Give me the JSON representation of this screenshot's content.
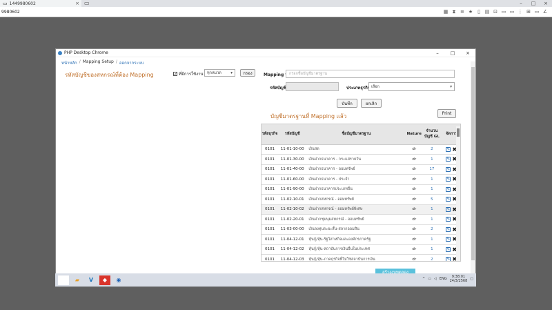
{
  "browser": {
    "tab_title": "1449980602",
    "address": "9980602"
  },
  "app": {
    "window_title": "PHP Desktop Chrome",
    "breadcrumb": [
      "หน้าหลัก",
      "Mapping Setup",
      "ออกจากระบบ"
    ]
  },
  "left": {
    "title": "รหัสบัญชีของสหกรณ์ที่ต้อง Mapping",
    "checkbox_label": "ที่มีการใช้งาน",
    "checkbox_checked": true,
    "filter_value": "ทุกหมวด",
    "filter_button": "กรอง"
  },
  "form": {
    "mapping_to_label": "Mapping to",
    "mapping_to_placeholder": "กรอกชื่อบัญชีมาตรฐาน",
    "account_code_label": "รหัสบัญชี",
    "account_code_value": "",
    "type_label": "ประเภทธุรกิจ",
    "type_value": "เลือก",
    "save_button": "บันทึก",
    "cancel_button": "ยกเลิก"
  },
  "mapped": {
    "title": "บัญชีมาตรฐานที่ Mapping แล้ว",
    "print_button": "Print",
    "columns": [
      "รหัสธุรกิจ",
      "รหัสบัญชี",
      "ชื่อบัญชีมาตรฐาน",
      "Nature",
      "จำนวนบัญชี GL",
      "จัดการ"
    ],
    "rows": [
      {
        "biz": "0101",
        "code": "11-01-10-00",
        "name": "เงินสด",
        "nature": "dr",
        "count": "2"
      },
      {
        "biz": "0101",
        "code": "11-01-30-00",
        "name": "เงินฝากธนาคาร - กระแสรายวัน",
        "nature": "dr",
        "count": "1"
      },
      {
        "biz": "0101",
        "code": "11-01-40-00",
        "name": "เงินฝากธนาคาร - ออมทรัพย์",
        "nature": "dr",
        "count": "17"
      },
      {
        "biz": "0101",
        "code": "11-01-60-00",
        "name": "เงินฝากธนาคาร - ประจำ",
        "nature": "dr",
        "count": "1"
      },
      {
        "biz": "0101",
        "code": "11-01-90-00",
        "name": "เงินฝากธนาคารประเภทอื่น",
        "nature": "dr",
        "count": "1"
      },
      {
        "biz": "0101",
        "code": "11-02-10-01",
        "name": "เงินฝากสหกรณ์ - ออมทรัพย์",
        "nature": "dr",
        "count": "5"
      },
      {
        "biz": "0101",
        "code": "11-02-10-02",
        "name": "เงินฝากสหกรณ์ - ออมทรัพย์พิเศษ",
        "nature": "dr",
        "count": "1"
      },
      {
        "biz": "0101",
        "code": "11-02-20-01",
        "name": "เงินฝากชุมนุมสหกรณ์ - ออมทรัพย์",
        "nature": "dr",
        "count": "1"
      },
      {
        "biz": "0101",
        "code": "11-03-00-00",
        "name": "เงินลงทุนระยะสั้น-สลากออมสิน",
        "nature": "dr",
        "count": "2"
      },
      {
        "biz": "0101",
        "code": "11-04-12-01",
        "name": "หุ้นกู้/หุ้น-รัฐวิสาหกิจและองค์กรภาครัฐ",
        "nature": "dr",
        "count": "1"
      },
      {
        "biz": "0101",
        "code": "11-04-12-02",
        "name": "หุ้นกู้/หุ้น-สถาบันการเงินอื่นในประเทศ",
        "nature": "dr",
        "count": "1"
      },
      {
        "biz": "0101",
        "code": "11-04-12-03",
        "name": "หุ้นกู้/หุ้น-ภาคธุรกิจที่ไม่ใช่สถาบันการเงิน",
        "nature": "dr",
        "count": "2"
      }
    ],
    "partial_button": "สร้างงบทดลอง"
  },
  "taskbar": {
    "lang": "ENG",
    "time": "9:38:01",
    "date": "24/3/2568",
    "badge": "2"
  },
  "colors": {
    "accent_orange": "#c0702a",
    "link_blue": "#2a6fb4",
    "button_cyan": "#5ac1dc"
  }
}
